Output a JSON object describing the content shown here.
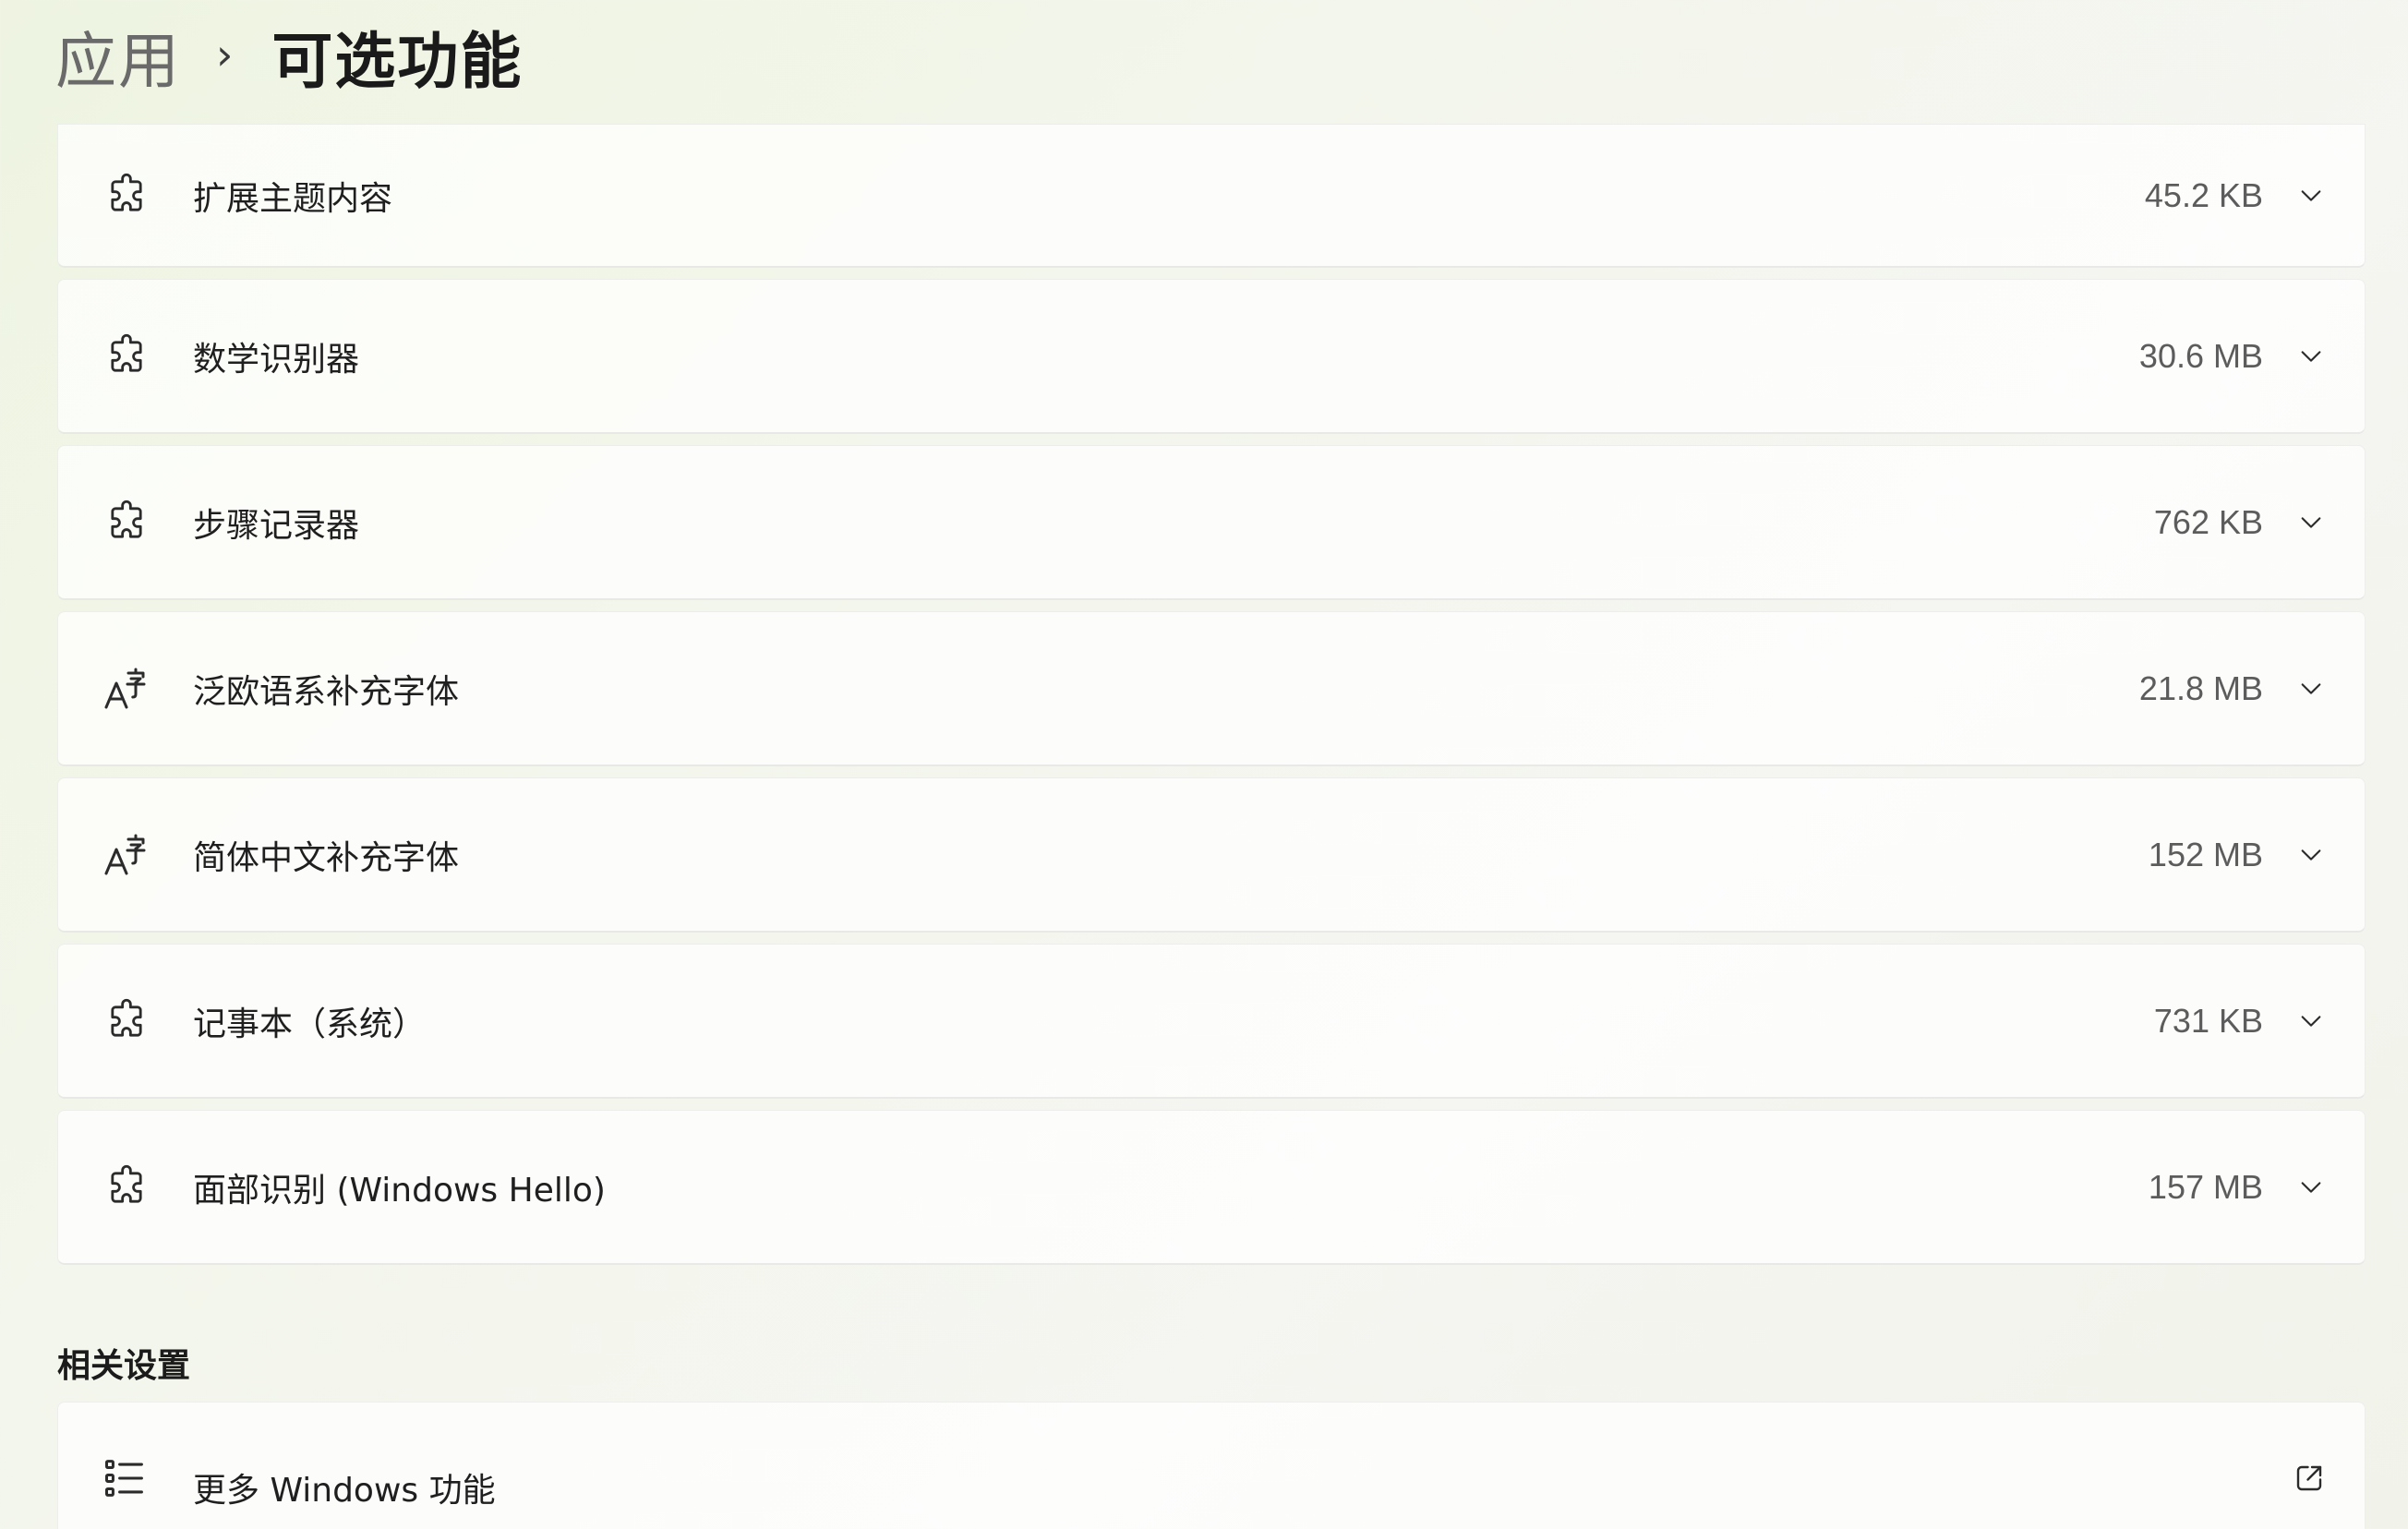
{
  "breadcrumb": {
    "parent": "应用",
    "separator": "›",
    "current": "可选功能"
  },
  "features": [
    {
      "name": "扩展主题内容",
      "size": "45.2 KB",
      "icon": "puzzle-icon"
    },
    {
      "name": "数学识别器",
      "size": "30.6 MB",
      "icon": "puzzle-icon"
    },
    {
      "name": "步骤记录器",
      "size": "762 KB",
      "icon": "puzzle-icon"
    },
    {
      "name": "泛欧语系补充字体",
      "size": "21.8 MB",
      "icon": "font-icon"
    },
    {
      "name": "简体中文补充字体",
      "size": "152 MB",
      "icon": "font-icon"
    },
    {
      "name": "记事本（系统）",
      "size": "731 KB",
      "icon": "puzzle-icon"
    },
    {
      "name": "面部识别 (Windows Hello)",
      "size": "157 MB",
      "icon": "puzzle-icon"
    }
  ],
  "related": {
    "title": "相关设置",
    "items": [
      {
        "label": "更多 Windows 功能",
        "icon": "list-icon",
        "action_icon": "open-external-icon"
      }
    ]
  }
}
